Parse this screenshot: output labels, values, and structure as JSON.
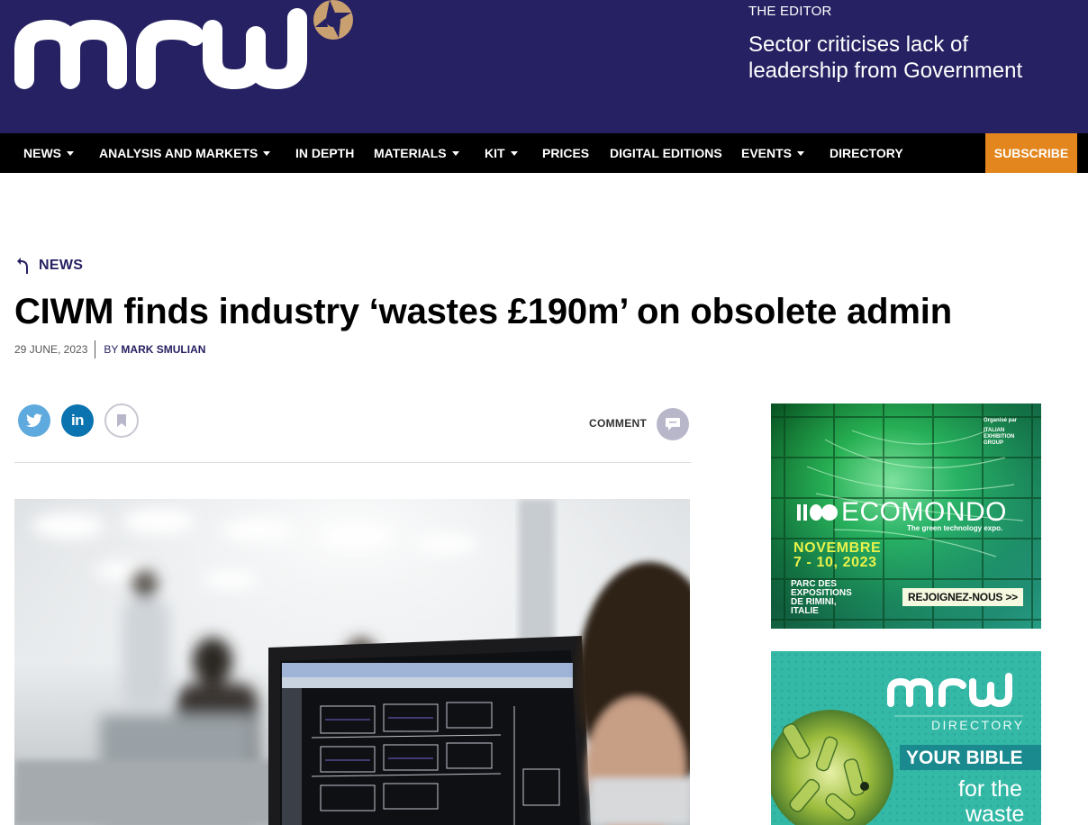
{
  "header": {
    "logo_text": "mrw",
    "editor_label": "THE EDITOR",
    "editor_headline": "Sector criticises lack of leadership from Government"
  },
  "nav": {
    "items": [
      {
        "label": "NEWS",
        "dropdown": true
      },
      {
        "label": "ANALYSIS AND MARKETS",
        "dropdown": true
      },
      {
        "label": "IN DEPTH",
        "dropdown": false
      },
      {
        "label": "MATERIALS",
        "dropdown": true
      },
      {
        "label": "KIT",
        "dropdown": true
      },
      {
        "label": "PRICES",
        "dropdown": false
      },
      {
        "label": "DIGITAL EDITIONS",
        "dropdown": false
      },
      {
        "label": "EVENTS",
        "dropdown": true
      },
      {
        "label": "DIRECTORY",
        "dropdown": false
      }
    ],
    "subscribe_label": "SUBSCRIBE"
  },
  "article": {
    "section": "NEWS",
    "title": "CIWM finds industry ‘wastes £190m’ on obsolete admin",
    "date": "29 JUNE, 2023",
    "by": "BY",
    "author": "MARK SMULIAN",
    "comment_label": "COMMENT"
  },
  "icons": {
    "back": "back-arrow-icon",
    "twitter": "twitter-icon",
    "linkedin": "linkedin-icon",
    "bookmark": "bookmark-icon",
    "comment": "comment-icon"
  },
  "ads": {
    "ecomondo": {
      "organizer_line1": "Organisé par",
      "organizer_line2": "ITALIAN",
      "organizer_line3": "EXHIBITION",
      "organizer_line4": "GROUP",
      "brand": "ECOMONDO",
      "tagline": "The green technology expo.",
      "month": "NOVEMBRE",
      "dates": "7 - 10, 2023",
      "venue_line1": "PARC DES",
      "venue_line2": "EXPOSITIONS",
      "venue_line3": "DE RIMINI,",
      "venue_line4": "ITALIE",
      "cta": "REJOIGNEZ-NOUS >>"
    },
    "directory": {
      "logo_text": "mrw",
      "label": "DIRECTORY",
      "banner": "YOUR BIBLE",
      "line1": "for the",
      "line2": "waste"
    }
  },
  "colors": {
    "masthead": "#262162",
    "nav_bg": "#000000",
    "subscribe": "#e2861d",
    "twitter": "#5ea9dd",
    "linkedin": "#0a73b0",
    "ad_green": "#1f8a3a",
    "ad_teal": "#2fb5a4"
  }
}
